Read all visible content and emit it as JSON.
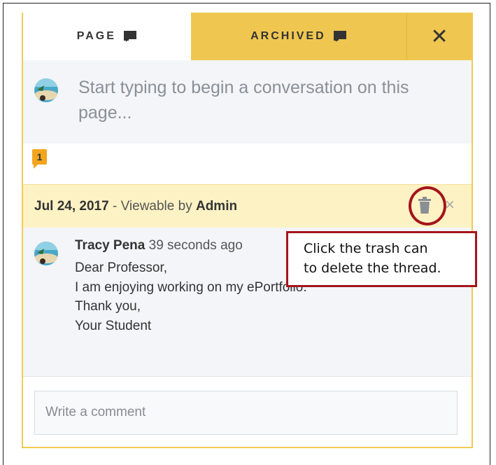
{
  "tabs": {
    "page_label": "PAGE",
    "archived_label": "ARCHIVED",
    "close_glyph": "✕"
  },
  "new_conversation": {
    "placeholder": "Start typing to begin a conversation on this page..."
  },
  "thread": {
    "count_badge": "1",
    "date": "Jul 24, 2017",
    "viewable_prefix": " - Viewable by ",
    "viewable_by": "Admin",
    "close_glyph": "×"
  },
  "comment": {
    "author": "Tracy Pena",
    "time_ago": "39 seconds ago",
    "body": "Dear Professor,\nI am enjoying working on my ePortfolio.\nThank you,\nYour Student"
  },
  "reply": {
    "placeholder": "Write a comment"
  },
  "callout": {
    "text": "Click the trash can\nto delete the thread."
  },
  "colors": {
    "accent_yellow": "#efc750",
    "thread_header_bg": "#fdf2c4",
    "badge_orange": "#f3a51f",
    "annotation_red": "#a5151b"
  },
  "icons": {
    "tab_icon": "chat-bubble-icon",
    "delete": "trash-icon",
    "close": "close-icon"
  }
}
